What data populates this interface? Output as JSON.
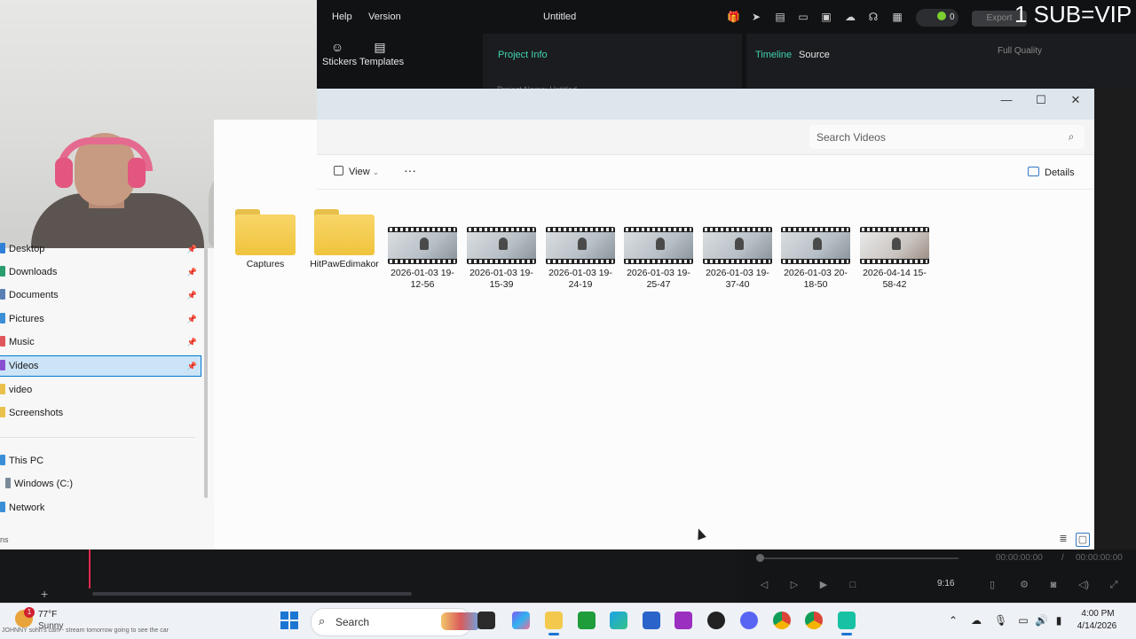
{
  "editor": {
    "menu": [
      "Help",
      "Version"
    ],
    "title": "Untitled",
    "credits": "0",
    "export_label": "Export",
    "overlay_text": "1 SUB=VIP",
    "tools": [
      {
        "icon": "sticker-icon",
        "label": "Stickers"
      },
      {
        "icon": "templates-icon",
        "label": "Templates"
      }
    ],
    "project_info_label": "Project Info",
    "project_name_label": "Project Name",
    "project_name_value": "Untitled",
    "tabs": [
      "Timeline",
      "Source"
    ],
    "quality": "Full Quality",
    "time_current": "00:00:00:00",
    "time_separator": "/",
    "time_total": "00:00:00:00",
    "aspect_ratio": "9:16"
  },
  "explorer": {
    "search_placeholder": "Search Videos",
    "view_label": "View",
    "more_label": "···",
    "details_label": "Details",
    "sidebar": [
      {
        "label": "Desktop",
        "pinned": true,
        "color": "#2f7fd8"
      },
      {
        "label": "Downloads",
        "pinned": true,
        "color": "#2a9d6e"
      },
      {
        "label": "Documents",
        "pinned": true,
        "color": "#5a7fb5"
      },
      {
        "label": "Pictures",
        "pinned": true,
        "color": "#3a8fd6"
      },
      {
        "label": "Music",
        "pinned": true,
        "color": "#e0565b"
      },
      {
        "label": "Videos",
        "pinned": true,
        "color": "#8a4fd1",
        "selected": true
      },
      {
        "label": "video",
        "pinned": false,
        "color": "#e9c04b"
      },
      {
        "label": "Screenshots",
        "pinned": false,
        "color": "#e9c04b"
      },
      {
        "label": "This PC",
        "pinned": false,
        "color": "#3a8fd6"
      },
      {
        "label": "Windows (C:)",
        "pinned": false,
        "color": "#7a8a99"
      },
      {
        "label": "Network",
        "pinned": false,
        "color": "#3a8fd6"
      }
    ],
    "footer_text": "ns",
    "items": [
      {
        "type": "folder",
        "name": "Captures"
      },
      {
        "type": "folder",
        "name": "HitPawEdimakor"
      },
      {
        "type": "video",
        "name": "2026-01-03 19-12-56"
      },
      {
        "type": "video",
        "name": "2026-01-03 19-15-39"
      },
      {
        "type": "video",
        "name": "2026-01-03 19-24-19"
      },
      {
        "type": "video",
        "name": "2026-01-03 19-25-47"
      },
      {
        "type": "video",
        "name": "2026-01-03 19-37-40"
      },
      {
        "type": "video",
        "name": "2026-01-03 20-18-50"
      },
      {
        "type": "video",
        "name": "2026-04-14 15-58-42"
      }
    ]
  },
  "taskbar": {
    "weather_badge": "1",
    "temperature": "77°F",
    "condition": "Sunny",
    "ticker": "JOHNNY sohn's cam - stream tomorrow going to see the car",
    "search_label": "Search",
    "time": "4:00 PM",
    "date": "4/14/2026"
  },
  "colors": {
    "accent": "#3fd3b0",
    "selection": "#cce4f7",
    "record_dot": "#e0294a"
  }
}
